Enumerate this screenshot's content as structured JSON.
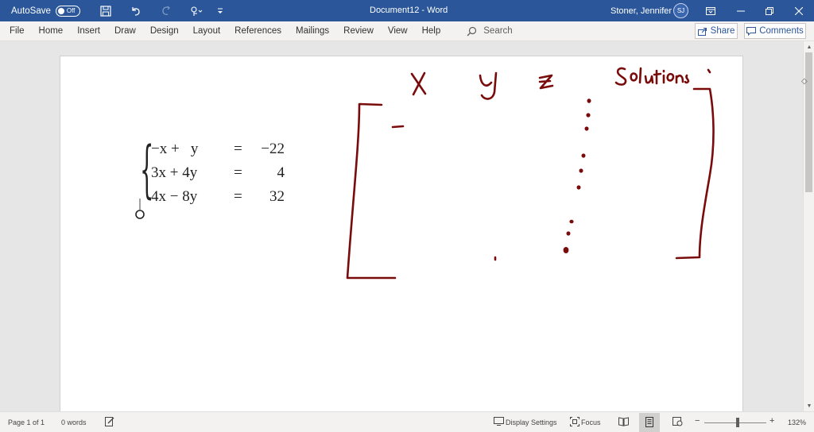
{
  "titlebar": {
    "autosave_label": "AutoSave",
    "autosave_state": "Off",
    "doc_title": "Document12 - Word",
    "user_name": "Stoner, Jennifer L",
    "user_initials": "SJ",
    "bg_color": "#2b579a"
  },
  "ribbon": {
    "tabs": [
      "File",
      "Home",
      "Insert",
      "Draw",
      "Design",
      "Layout",
      "References",
      "Mailings",
      "Review",
      "View",
      "Help"
    ],
    "search_label": "Search",
    "share_label": "Share",
    "comments_label": "Comments"
  },
  "document": {
    "equations": [
      {
        "lhs": "−x +   y",
        "rhs": "−22"
      },
      {
        "lhs": "3x + 4y",
        "rhs": "4"
      },
      {
        "lhs": "4x − 8y",
        "rhs": "32"
      }
    ],
    "eq_sign": "=",
    "ink": {
      "color": "#8b0000",
      "column_labels": [
        "X",
        "y",
        "z",
        "Solutions"
      ]
    }
  },
  "statusbar": {
    "page": "Page 1 of 1",
    "words": "0 words",
    "display_settings": "Display Settings",
    "focus": "Focus",
    "zoom": "132%",
    "zoom_minus": "−",
    "zoom_plus": "+"
  }
}
